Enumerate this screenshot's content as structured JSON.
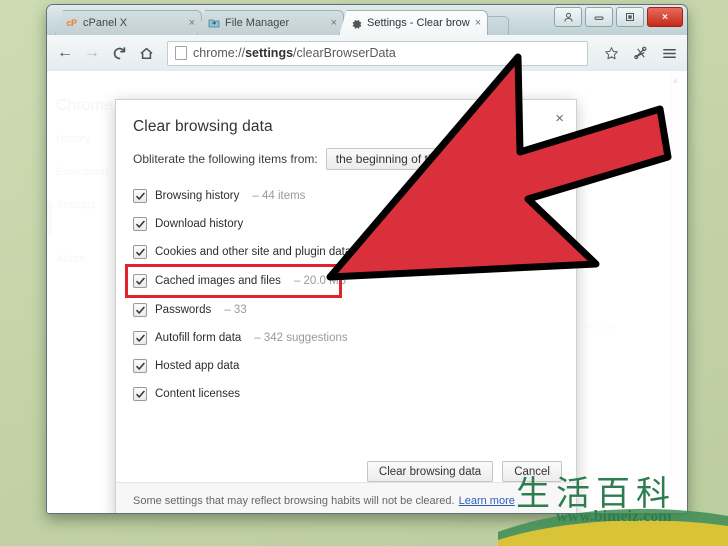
{
  "window": {
    "buttons": [
      {
        "name": "user-profile",
        "glyph": "person"
      },
      {
        "name": "minimize",
        "glyph": "minimize"
      },
      {
        "name": "maximize",
        "glyph": "maximize"
      },
      {
        "name": "close",
        "glyph": "×"
      }
    ]
  },
  "tabs": [
    {
      "label": "cPanel X",
      "favicon": "cP",
      "close": "×",
      "active": false
    },
    {
      "label": "File Manager",
      "favicon": "folder-arrow",
      "close": "×",
      "active": false
    },
    {
      "label": "Settings - Clear brow",
      "favicon": "gear",
      "close": "×",
      "active": true
    }
  ],
  "toolbar": {
    "back": "←",
    "forward": "→",
    "reload": "C",
    "home": "⌂",
    "url_prefix": "chrome://",
    "url_bold": "settings",
    "url_suffix": "/clearBrowserData",
    "url_full": "chrome://settings/clearBrowserData",
    "bookmark_star": "☆",
    "extension": "extension-icon",
    "menu": "≡"
  },
  "settings_page": {
    "brand": "Chrome",
    "sidebar": [
      "History",
      "Extensions",
      "Settings"
    ],
    "sidebar_about": "About",
    "ghost_label": "ettings",
    "scroll_up": "▲"
  },
  "dialog": {
    "title": "Clear browsing data",
    "close": "×",
    "obliterate_label": "Obliterate the following items from:",
    "time_range": "the beginning of time",
    "items": [
      {
        "label": "Browsing history",
        "meta": "–  44 items",
        "checked": true,
        "highlighted": false
      },
      {
        "label": "Download history",
        "meta": "",
        "checked": true,
        "highlighted": false
      },
      {
        "label": "Cookies and other site and plugin data",
        "meta": "",
        "checked": true,
        "highlighted": false
      },
      {
        "label": "Cached images and files",
        "meta": "–  20.0 MB",
        "checked": true,
        "highlighted": true
      },
      {
        "label": "Passwords",
        "meta": "–  33",
        "checked": true,
        "highlighted": false
      },
      {
        "label": "Autofill form data",
        "meta": "–  342 suggestions",
        "checked": true,
        "highlighted": false
      },
      {
        "label": "Hosted app data",
        "meta": "",
        "checked": true,
        "highlighted": false
      },
      {
        "label": "Content licenses",
        "meta": "",
        "checked": true,
        "highlighted": false
      }
    ],
    "primary_button": "Clear browsing data",
    "secondary_button": "Cancel",
    "note_text": "Some settings that may reflect browsing habits will not be cleared.",
    "note_link": "Learn more"
  },
  "annotation": {
    "arrow_fill": "#d9303c",
    "arrow_stroke": "#000000",
    "highlight_color": "#e0242b"
  },
  "watermark": {
    "cn_text": "生活百科",
    "url": "www.bimeiz.com",
    "color": "#2f7d4f"
  }
}
